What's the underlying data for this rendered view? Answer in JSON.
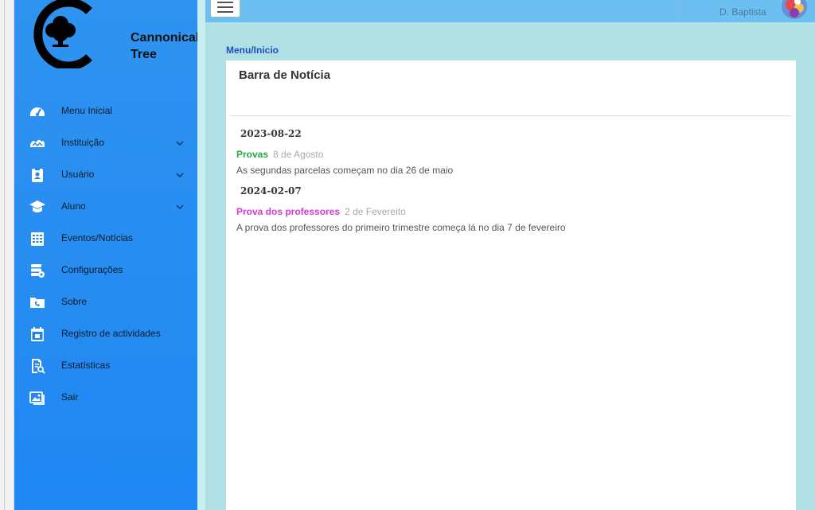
{
  "brand": {
    "name_line1": "Cannonical",
    "name_line2": "Tree"
  },
  "sidebar": {
    "items": [
      {
        "label": "Menu Inicial",
        "icon": "speedometer-icon",
        "has_chevron": false
      },
      {
        "label": "Instituição",
        "icon": "institution-icon",
        "has_chevron": true
      },
      {
        "label": "Usuário",
        "icon": "user-badge-icon",
        "has_chevron": true
      },
      {
        "label": "Aluno",
        "icon": "graduation-cap-icon",
        "has_chevron": true
      },
      {
        "label": "Eventos/Notícias",
        "icon": "calendar-grid-icon",
        "has_chevron": false
      },
      {
        "label": "Configurações",
        "icon": "settings-stack-icon",
        "has_chevron": false
      },
      {
        "label": "Sobre",
        "icon": "phone-folder-icon",
        "has_chevron": false
      },
      {
        "label": "Registro de actividades",
        "icon": "calendar-icon",
        "has_chevron": false
      },
      {
        "label": "Estatísticas",
        "icon": "report-search-icon",
        "has_chevron": false
      },
      {
        "label": "Sair",
        "icon": "image-gallery-icon",
        "has_chevron": false
      }
    ]
  },
  "topbar": {
    "user_name": "D. Baptista"
  },
  "breadcrumb": "Menu/Inicio",
  "panel": {
    "title": "Barra de Notícia",
    "news": [
      {
        "date": "2023-08-22",
        "title": "Provas",
        "title_color": "#28a745",
        "subtitle": "8 de Agosto",
        "body": "As segundas parcelas começam no dia 26 de maio"
      },
      {
        "date": "2024-02-07",
        "title": "Prova dos professores",
        "title_color": "#d63ad6",
        "subtitle": "2 de Fevereito",
        "body": "A prova dos professores do primeiro trimestre começa lá no dia 7 de fevereiro"
      }
    ]
  },
  "colors": {
    "sidebar": "#2f93f0",
    "topbar": "#6bbff1",
    "background": "#b0e0e4",
    "breadcrumb": "#1a4fc2"
  }
}
